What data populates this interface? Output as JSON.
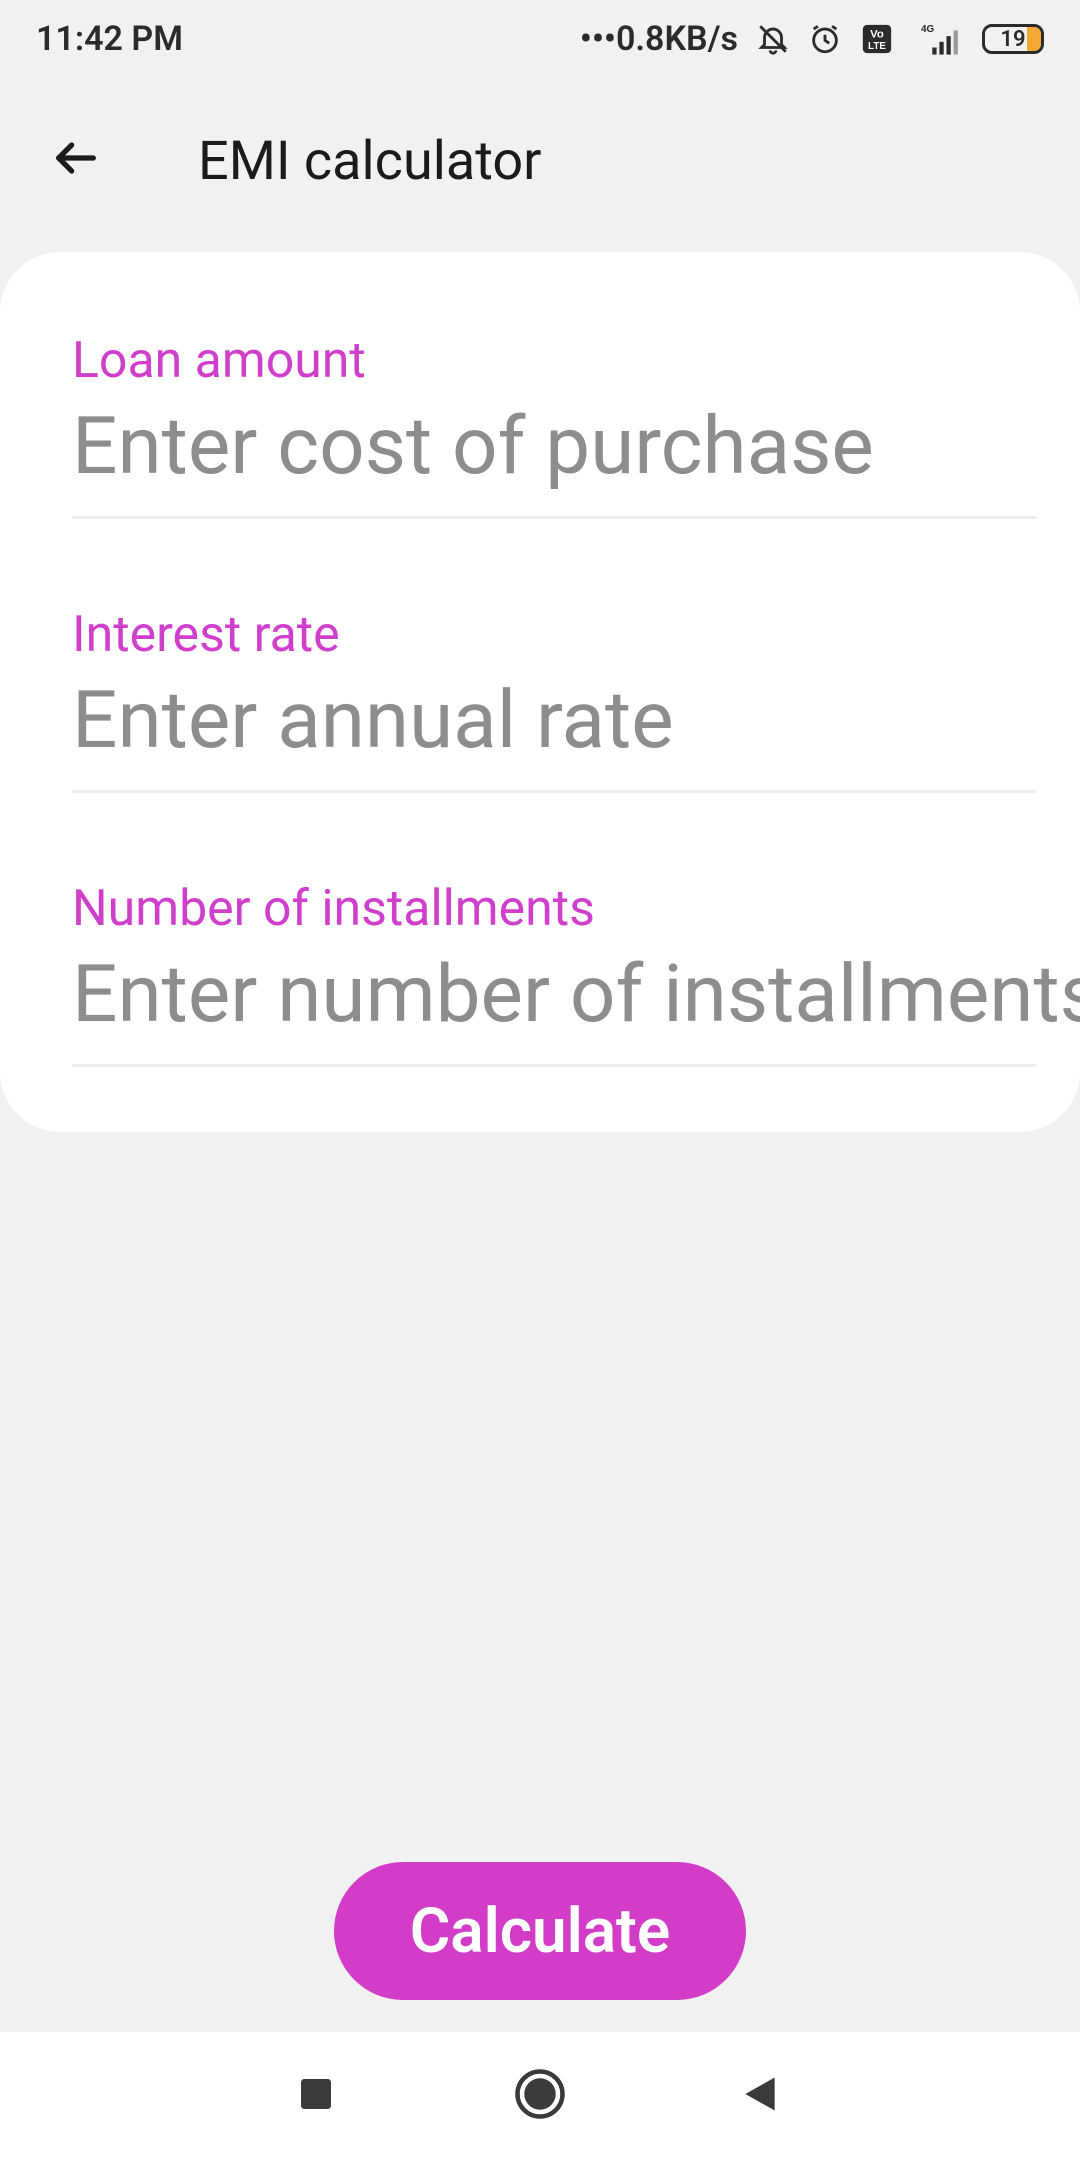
{
  "status_bar": {
    "time": "11:42 PM",
    "net_speed": "•••0.8KB/s",
    "network_type": "4G",
    "volte_label": "Vo LTE",
    "battery_level": "19",
    "icons": [
      "mute-bell-icon",
      "alarm-icon",
      "volte-icon",
      "signal-icon",
      "battery-icon"
    ]
  },
  "app_bar": {
    "title": "EMI calculator",
    "back_icon": "arrow-left-icon"
  },
  "form": {
    "loan": {
      "label": "Loan amount",
      "placeholder": "Enter cost of purchase",
      "value": ""
    },
    "interest": {
      "label": "Interest rate",
      "placeholder": "Enter annual rate",
      "value": ""
    },
    "installments": {
      "label": "Number of installments",
      "placeholder": "Enter number of installments",
      "value": ""
    }
  },
  "actions": {
    "calculate_label": "Calculate"
  },
  "nav_bar": {
    "items": [
      "recents-square-icon",
      "home-circle-icon",
      "back-triangle-icon"
    ]
  },
  "colors": {
    "accent": "#cf3fcb",
    "button": "#d23cc6",
    "background": "#f1f1f1",
    "card": "#ffffff"
  }
}
